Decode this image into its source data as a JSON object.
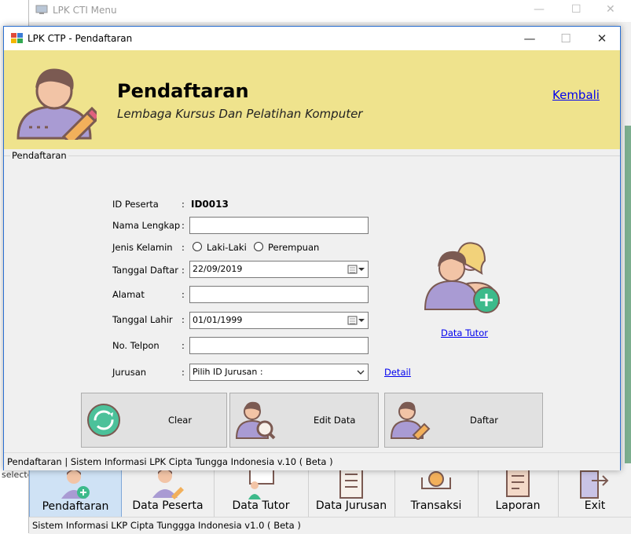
{
  "background_window": {
    "title": "LPK CTI Menu",
    "controls": {
      "minimize": "—",
      "maximize": "☐",
      "close": "✕"
    },
    "toolbar": [
      {
        "label": "Pendaftaran",
        "icon": "user-add-icon",
        "active": true
      },
      {
        "label": "Data Peserta",
        "icon": "user-edit-icon",
        "active": false
      },
      {
        "label": "Data Tutor",
        "icon": "presentation-icon",
        "active": false
      },
      {
        "label": "Data Jurusan",
        "icon": "list-icon",
        "active": false
      },
      {
        "label": "Transaksi",
        "icon": "money-icon",
        "active": false
      },
      {
        "label": "Laporan",
        "icon": "report-icon",
        "active": false
      },
      {
        "label": "Exit",
        "icon": "exit-icon",
        "active": false
      }
    ],
    "status": "Sistem Informasi LKP Cipta Tunggga Indonesia v1.0 ( Beta )",
    "left_partial_text": "selecte"
  },
  "window": {
    "title": "LPK CTP - Pendaftaran",
    "controls": {
      "minimize": "—",
      "maximize": "☐",
      "close": "✕"
    }
  },
  "header": {
    "title": "Pendaftaran",
    "subtitle": "Lembaga Kursus Dan Pelatihan Komputer",
    "back_link": "Kembali",
    "bg_color": "#efe38d"
  },
  "group": {
    "label": "Pendaftaran"
  },
  "form": {
    "id_label": "ID Peserta",
    "id_value": "ID0013",
    "name_label": "Nama Lengkap",
    "name_value": "",
    "gender_label": "Jenis Kelamin",
    "gender_options": [
      "Laki-Laki",
      "Perempuan"
    ],
    "date_label": "Tanggal Daftar",
    "date_value": "22/09/2019",
    "address_label": "Alamat",
    "address_value": "",
    "birth_label": "Tanggal Lahir",
    "birth_value": "01/01/1999",
    "phone_label": "No. Telpon",
    "phone_value": "",
    "major_label": "Jurusan",
    "major_value": "Pilih ID Jurusan :",
    "colon": ":"
  },
  "links": {
    "detail": "Detail",
    "tutor": "Data Tutor"
  },
  "buttons": {
    "clear": "Clear",
    "edit": "Edit Data",
    "submit": "Daftar"
  },
  "status": "Pendaftaran | Sistem Informasi LPK Cipta Tungga Indonesia v.10 ( Beta )"
}
